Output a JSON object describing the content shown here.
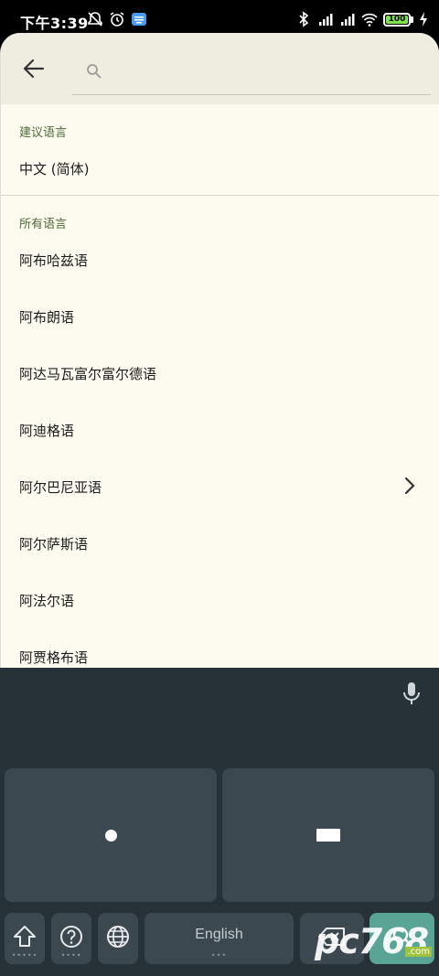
{
  "status_bar": {
    "time": "下午3:39",
    "battery": "100",
    "battery_level": 1.0,
    "icons": [
      "mute-icon",
      "alarm-icon",
      "keyboard-app-icon",
      "bluetooth-icon",
      "signal-hd-icon",
      "signal-hd-icon",
      "wifi-icon",
      "battery-icon",
      "charging-icon"
    ]
  },
  "header": {
    "back_icon": "arrow-left-icon",
    "search_icon": "search-icon",
    "search_value": ""
  },
  "suggested": {
    "title": "建议语言",
    "items": [
      {
        "label": "中文 (简体)"
      }
    ]
  },
  "all": {
    "title": "所有语言",
    "items": [
      {
        "label": "阿布哈兹语"
      },
      {
        "label": "阿布朗语"
      },
      {
        "label": "阿达马瓦富尔富尔德语"
      },
      {
        "label": "阿迪格语"
      },
      {
        "label": "阿尔巴尼亚语",
        "has_submenu": true
      },
      {
        "label": "阿尔萨斯语"
      },
      {
        "label": "阿法尔语"
      },
      {
        "label": "阿贾格布语"
      }
    ]
  },
  "keyboard": {
    "space_label": "English",
    "colors": {
      "background": "#263238",
      "key": "#3b4850",
      "action_key": "#5aa496"
    }
  },
  "watermark": {
    "text": "pc768",
    "sub": ".com"
  },
  "colors": {
    "sheet": "#fdfaf0",
    "header": "#efede0",
    "section_label": "#4f6a3a"
  }
}
